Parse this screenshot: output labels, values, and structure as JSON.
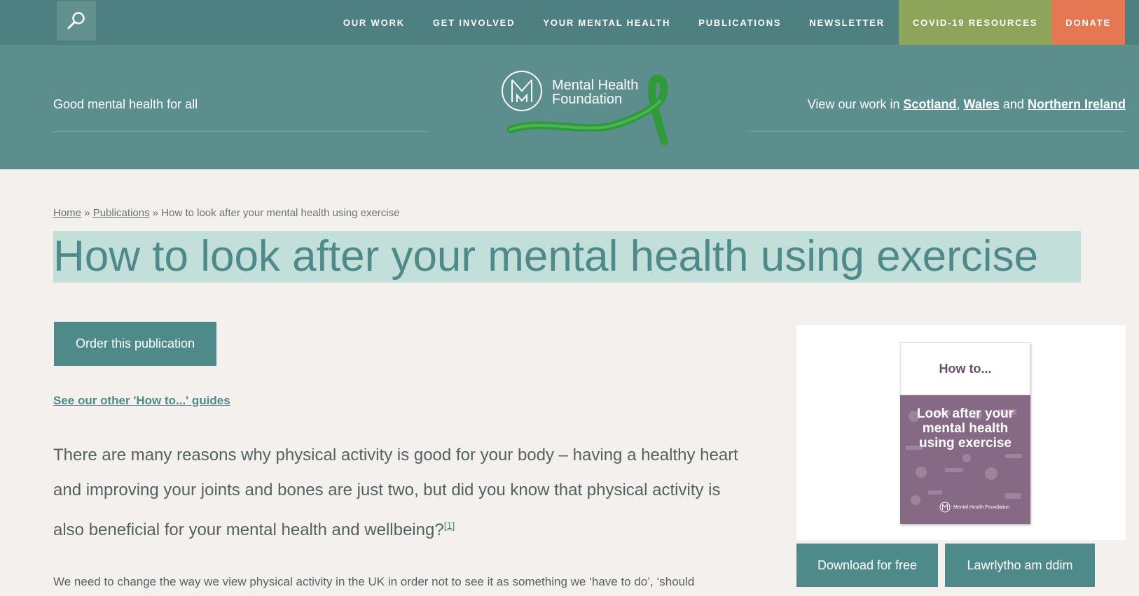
{
  "nav": {
    "items": [
      "OUR WORK",
      "GET INVOLVED",
      "YOUR MENTAL HEALTH",
      "PUBLICATIONS",
      "NEWSLETTER"
    ],
    "covid_label": "COVID-19 RESOURCES",
    "donate_label": "DONATE",
    "covid_color": "#8ea45a",
    "donate_color": "#e57853"
  },
  "header": {
    "tagline": "Good mental health for all",
    "logo_line1": "Mental Health",
    "logo_line2": "Foundation",
    "region_intro": "View our work in",
    "region_scotland": "Scotland",
    "region_wales": "Wales",
    "region_and": "and",
    "region_ni": "Northern Ireland"
  },
  "breadcrumb": {
    "home": "Home",
    "publications": "Publications",
    "sep": "»",
    "current": "How to look after your mental health using exercise"
  },
  "main": {
    "title": "How to look after your mental health using exercise",
    "order_label": "Order this publication",
    "other_guides": "See our other 'How to...' guides",
    "lead": "There are many reasons why physical activity is good for your body – having a healthy heart and improving your joints and bones are just two, but did you know that physical activity is also beneficial for your mental health and wellbeing?",
    "footnote": "[1]",
    "body": "We need to change the way we view physical activity in the UK in order not to see it as something we ‘have to do’, ‘should"
  },
  "sidebar": {
    "cover_top": "How to...",
    "cover_title": "Look after your mental health using exercise",
    "cover_logo": "Mental Health Foundation",
    "download_label": "Download for free",
    "read_label": "Lawrlytho am ddim"
  },
  "colors": {
    "nav_bg": "#4e7f81",
    "header_bg": "#5b8e8d",
    "accent": "#4e8a89",
    "title_highlight": "#c3dfda",
    "ribbon": "#2e9a3a"
  }
}
